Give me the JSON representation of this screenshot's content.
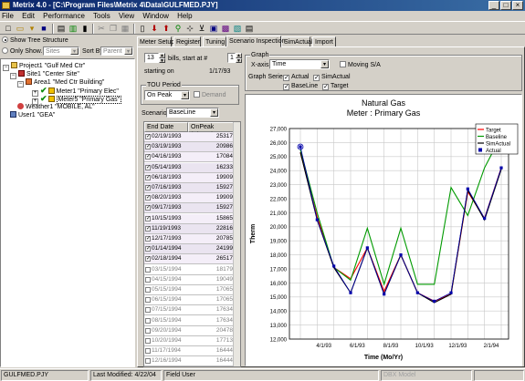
{
  "window": {
    "title": "Metrix 4.0 - [C:\\Program Files\\Metrix 4\\Data\\GULFMED.PJY]"
  },
  "menu": [
    "File",
    "Edit",
    "Performance",
    "Tools",
    "View",
    "Window",
    "Help"
  ],
  "tree_panel": {
    "show_tree_label": "Show Tree Structure",
    "only_show_label": "Only Show...",
    "only_show_value": "Sites",
    "sort_by_label": "Sort By",
    "sort_by_value": "Parent",
    "nodes": [
      {
        "label": "Project1 \"Gulf Med Ctr\""
      },
      {
        "label": "Site1 \"Center Site\""
      },
      {
        "label": "Area1 \"Med Ctr Building\""
      },
      {
        "label": "Meter1 \"Primary Elec\""
      },
      {
        "label": "Meter5 \"Primary Gas\""
      },
      {
        "label": "Weather1 \"MOBILE, AL\""
      },
      {
        "label": "User1 \"GEA\""
      }
    ]
  },
  "tabs": [
    "Meter Setup",
    "Register",
    "Tuning",
    "Scenario Inspection",
    "SimActual",
    "Import"
  ],
  "inspection": {
    "bills_value": "13",
    "bills_label": "bills, start at #",
    "start_num": "1",
    "starting_on_label": "starting on",
    "starting_on_value": "1/17/93",
    "tou_group_label": "TOU Period",
    "tou_value": "On Peak",
    "demand_label": "Demand",
    "scenario_label": "Scenario",
    "scenario_value": "BaseLine"
  },
  "grid": {
    "columns": [
      "End Date",
      "OnPeak (Therm)"
    ],
    "rows": [
      {
        "date": "02/19/1993",
        "value": "25317",
        "checked": true
      },
      {
        "date": "03/19/1993",
        "value": "20986",
        "checked": true
      },
      {
        "date": "04/16/1993",
        "value": "17084",
        "checked": true
      },
      {
        "date": "05/14/1993",
        "value": "16233",
        "checked": true
      },
      {
        "date": "06/18/1993",
        "value": "19909",
        "checked": true
      },
      {
        "date": "07/16/1993",
        "value": "15927",
        "checked": true
      },
      {
        "date": "08/20/1993",
        "value": "19909",
        "checked": true
      },
      {
        "date": "09/17/1993",
        "value": "15927",
        "checked": true
      },
      {
        "date": "10/15/1993",
        "value": "15865",
        "checked": true
      },
      {
        "date": "11/19/1993",
        "value": "22816",
        "checked": true
      },
      {
        "date": "12/17/1993",
        "value": "20785",
        "checked": true
      },
      {
        "date": "01/14/1994",
        "value": "24199",
        "checked": true
      },
      {
        "date": "02/18/1994",
        "value": "26517",
        "checked": true
      },
      {
        "date": "03/15/1994",
        "value": "18179",
        "checked": false
      },
      {
        "date": "04/15/1994",
        "value": "19049",
        "checked": false
      },
      {
        "date": "05/15/1994",
        "value": "17065",
        "checked": false
      },
      {
        "date": "06/15/1994",
        "value": "17065",
        "checked": false
      },
      {
        "date": "07/15/1994",
        "value": "17634",
        "checked": false
      },
      {
        "date": "08/15/1994",
        "value": "17634",
        "checked": false
      },
      {
        "date": "09/20/1994",
        "value": "20478",
        "checked": false
      },
      {
        "date": "10/20/1994",
        "value": "17713",
        "checked": false
      },
      {
        "date": "11/17/1994",
        "value": "16444",
        "checked": false
      },
      {
        "date": "12/16/1994",
        "value": "16444",
        "checked": false
      }
    ]
  },
  "graph_options": {
    "group_label": "Graph",
    "xaxis_label": "X-axis",
    "xaxis_value": "Time",
    "moving_label": "Moving S/A",
    "series_label": "Graph Series",
    "actual_label": "Actual",
    "simactual_label": "SimActual",
    "baseline_label": "BaseLine",
    "target_label": "Target"
  },
  "chart_data": {
    "type": "line",
    "title": "Natural Gas",
    "subtitle": "Meter : Primary Gas",
    "xlabel": "Time (Mo/Yr)",
    "ylabel": "Therm",
    "ylim": [
      12000,
      27000
    ],
    "yticks": [
      12000,
      13000,
      14000,
      15000,
      16000,
      17000,
      18000,
      19000,
      20000,
      21000,
      22000,
      23000,
      24000,
      25000,
      26000,
      27000
    ],
    "x": [
      "2/93",
      "3/93",
      "4/93",
      "5/93",
      "6/93",
      "7/93",
      "8/93",
      "9/93",
      "10/93",
      "11/93",
      "12/93",
      "1/94",
      "2/94"
    ],
    "xtick_labels": [
      "4/1/93",
      "6/1/93",
      "8/1/93",
      "10/1/93",
      "12/1/93",
      "2/1/94"
    ],
    "grid": true,
    "legend_position": "top-right",
    "series": [
      {
        "name": "Target",
        "color": "#ff0000",
        "values": [
          25300,
          20700,
          17100,
          16300,
          18500,
          15400,
          18000,
          15300,
          14700,
          15200,
          22500,
          20600,
          24200
        ]
      },
      {
        "name": "Baseline",
        "color": "#009a00",
        "values": [
          25500,
          21000,
          17100,
          16200,
          19900,
          15900,
          19900,
          15900,
          15900,
          22800,
          20800,
          24200,
          26500
        ]
      },
      {
        "name": "SimActual",
        "color": "#000000",
        "values": [
          25300,
          20500,
          17100,
          15300,
          18500,
          15200,
          18000,
          15300,
          14600,
          15200,
          22600,
          20500,
          24100
        ]
      },
      {
        "name": "Actual",
        "color": "#0000aa",
        "values": [
          25700,
          20500,
          17200,
          15300,
          18500,
          15200,
          18000,
          15300,
          14700,
          15300,
          22700,
          20600,
          24200
        ]
      }
    ]
  },
  "status": {
    "file": "GULFMED.PJY",
    "modified": "Last Modified: 4/22/04",
    "user": "Field User",
    "mode": "DBX Model"
  }
}
